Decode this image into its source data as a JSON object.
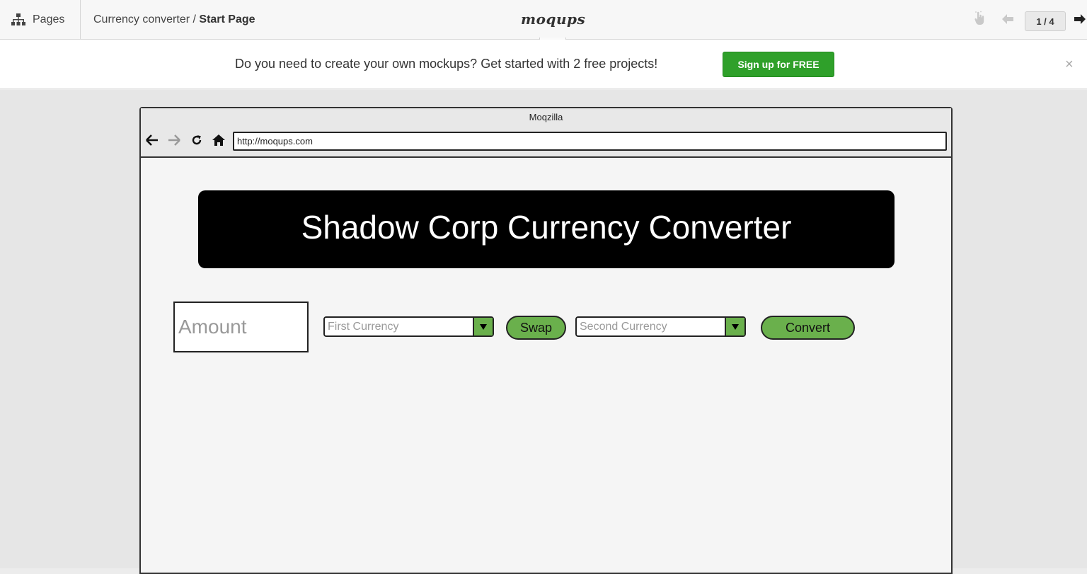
{
  "toolbar": {
    "pages_label": "Pages",
    "breadcrumb_project": "Currency converter / ",
    "breadcrumb_page": "Start Page",
    "logo": "moqups",
    "dots": "...",
    "page_counter": "1 / 4"
  },
  "banner": {
    "text": "Do you need to create your own mockups? Get started with 2 free projects!",
    "signup_label": "Sign up for FREE",
    "close_glyph": "×"
  },
  "mockup": {
    "browser_title": "Moqzilla",
    "url": "http://moqups.com",
    "header_title": "Shadow Corp Currency Converter",
    "amount_placeholder": "Amount",
    "first_currency_placeholder": "First Currency",
    "swap_label": "Swap",
    "second_currency_placeholder": "Second Currency",
    "convert_label": "Convert"
  },
  "icons": {
    "pages": "sitemap-icon",
    "hand": "hand-pointer-icon",
    "prev": "arrow-left-icon",
    "next": "arrow-right-icon",
    "back": "browser-back-icon",
    "forward": "browser-forward-icon",
    "reload": "reload-icon",
    "home": "home-icon"
  },
  "colors": {
    "signup_green": "#2fa02a",
    "mockup_green": "#6ab04c",
    "header_black": "#000000"
  }
}
